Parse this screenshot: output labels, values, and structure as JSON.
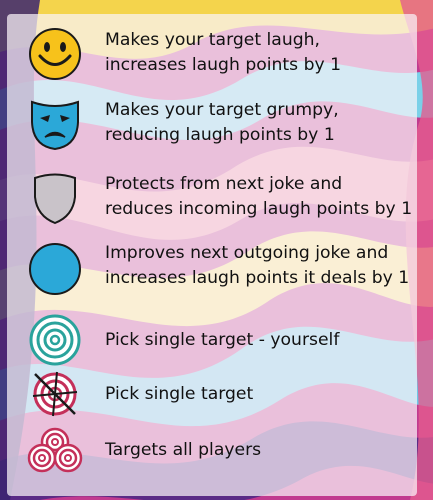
{
  "legend": {
    "items": [
      {
        "icon": "smiley-face-icon",
        "line1": "Makes your target laugh,",
        "line2": "increases laugh points by 1"
      },
      {
        "icon": "sad-mask-icon",
        "line1": "Makes your target grumpy,",
        "line2": "reducing laugh points by 1"
      },
      {
        "icon": "shield-icon",
        "line1": "Protects from next joke and",
        "line2": "reduces incoming laugh points by 1"
      },
      {
        "icon": "blue-circle-icon",
        "line1": "Improves next outgoing joke and",
        "line2": "increases laugh points it deals by 1"
      },
      {
        "icon": "self-target-icon",
        "line1": "Pick single target - yourself"
      },
      {
        "icon": "crosshair-target-icon",
        "line1": "Pick single target"
      },
      {
        "icon": "multi-target-icon",
        "line1": "Targets all players"
      }
    ]
  },
  "colors": {
    "smiley_fill": "#f7c21b",
    "mask_fill": "#2ba8d8",
    "shield_fill": "#c9c3c9",
    "boost_circle": "#2ba8d8",
    "self_target": "#2aa39c",
    "enemy_target": "#c4305a"
  }
}
